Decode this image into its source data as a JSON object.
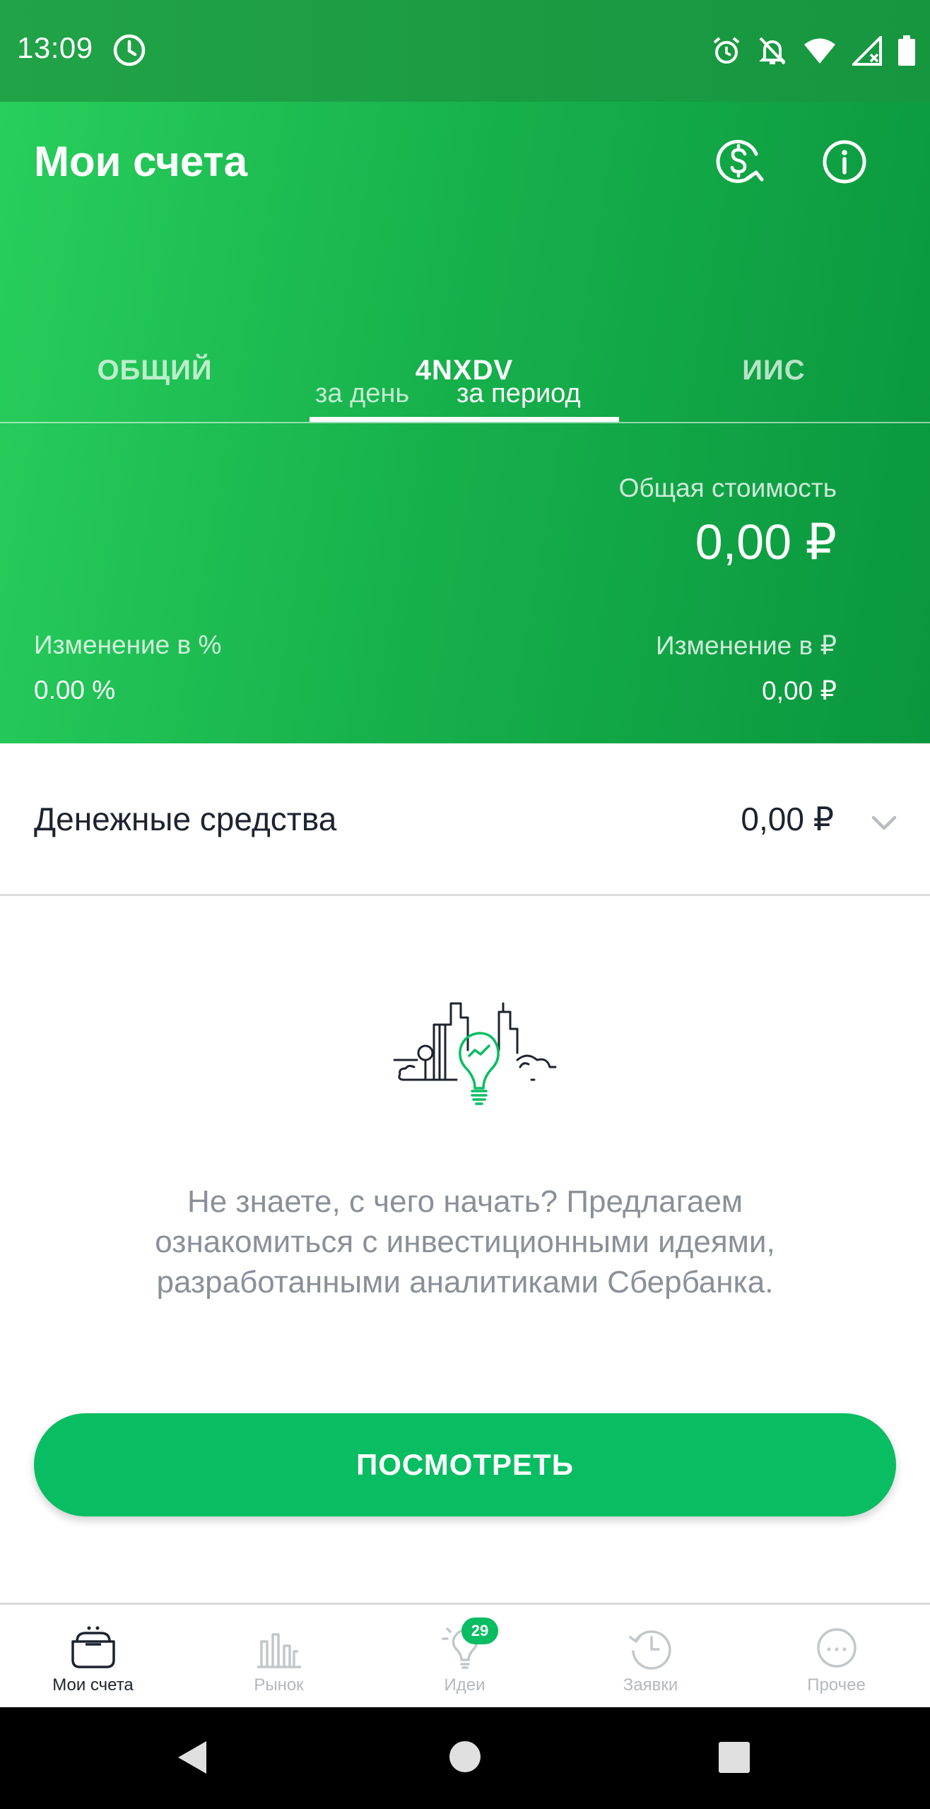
{
  "status_bar": {
    "time": "13:09",
    "icons": [
      "clock-icon",
      "alarm-icon",
      "bell-off-icon",
      "wifi-icon",
      "signal-icon",
      "battery-icon"
    ]
  },
  "header": {
    "title": "Мои счета",
    "actions": [
      "currency-exchange-icon",
      "info-icon"
    ],
    "tabs": [
      {
        "label": "ОБЩИЙ",
        "active": false
      },
      {
        "label": "4NXDV",
        "active": true
      },
      {
        "label": "ИИС",
        "active": false
      }
    ],
    "period": {
      "day": "за день",
      "range": "за период",
      "selected": "за период"
    },
    "total": {
      "label": "Общая стоимость",
      "value": "0,00 ₽"
    },
    "change_percent": {
      "label": "Изменение в  %",
      "value": "0.00  %"
    },
    "change_rub": {
      "label": "Изменение в ₽",
      "value": "0,00 ₽"
    }
  },
  "cash": {
    "label": "Денежные средства",
    "value": "0,00 ₽"
  },
  "promo": {
    "text": "Не знаете, с чего начать? Предлагаем ознакомиться с инвестиционными идеями, разработанными аналитиками Сбербанка.",
    "button_label": "ПОСМОТРЕТЬ"
  },
  "bottom_nav": {
    "items": [
      {
        "label": "Мои счета",
        "icon": "wallet-icon",
        "active": true
      },
      {
        "label": "Рынок",
        "icon": "market-icon",
        "active": false
      },
      {
        "label": "Идеи",
        "icon": "lightbulb-icon",
        "active": false,
        "badge": "29"
      },
      {
        "label": "Заявки",
        "icon": "history-icon",
        "active": false
      },
      {
        "label": "Прочее",
        "icon": "more-icon",
        "active": false
      }
    ]
  },
  "colors": {
    "header_start": "#28cf5c",
    "header_end": "#0a963e",
    "accent": "#08bd62",
    "text_dark": "#1d2330",
    "text_muted": "#8a9099"
  }
}
